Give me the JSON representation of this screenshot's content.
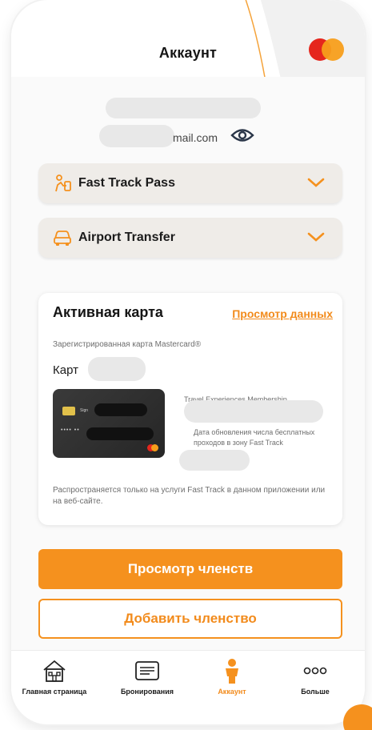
{
  "header": {
    "title": "Аккаунт",
    "brand_icon": "mastercard-logo-icon"
  },
  "user": {
    "email_suffix": "mail.com",
    "visibility_icon": "eye-icon"
  },
  "accordions": [
    {
      "label": "Fast Track Pass",
      "icon": "fast-track-icon"
    },
    {
      "label": "Airport Transfer",
      "icon": "car-icon"
    }
  ],
  "active_card": {
    "title": "Активная карта",
    "details_link": "Просмотр данных",
    "registered_text": "Зарегистрированная карта Mastercard®",
    "card_label": "Карт",
    "membership_label": "Travel Experiences Membership",
    "update_note": "Дата обновления числа бесплатных проходов в зону Fast Track",
    "footnote": "Распространяется только на услуги Fast Track в данном приложении или на веб-сайте.",
    "card_dots": "•••• ••"
  },
  "buttons": {
    "view_memberships": "Просмотр членств",
    "add_membership": "Добавить членство"
  },
  "tabbar": {
    "items": [
      {
        "label": "Главная страница",
        "icon": "home-icon"
      },
      {
        "label": "Бронирования",
        "icon": "ticket-icon"
      },
      {
        "label": "Аккаунт",
        "icon": "account-person-icon",
        "active": true
      },
      {
        "label": "Больше",
        "icon": "more-dots-icon"
      }
    ]
  },
  "colors": {
    "accent": "#f5911e",
    "accent_text": "#f28b1c",
    "panel_bg": "#efece8"
  }
}
